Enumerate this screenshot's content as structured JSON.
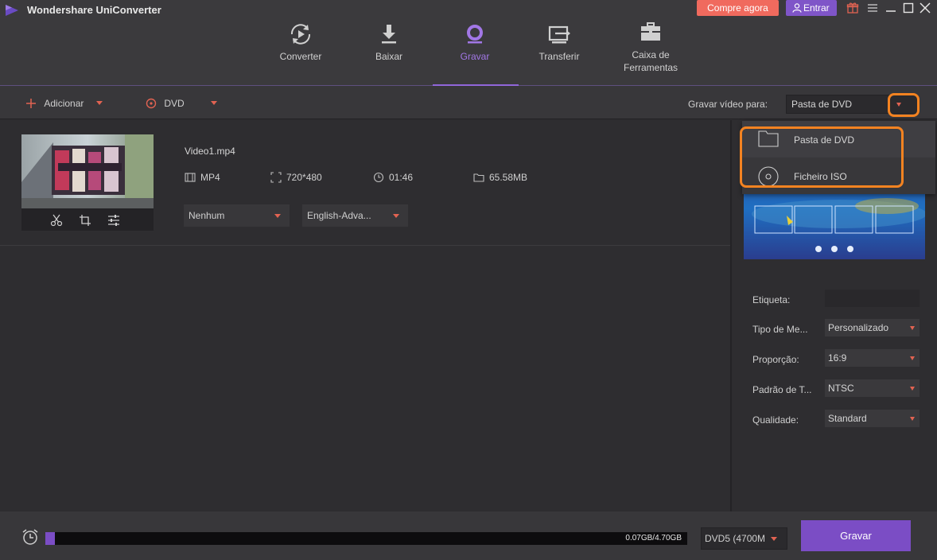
{
  "app": {
    "title": "Wondershare UniConverter"
  },
  "header": {
    "buy_label": "Compre agora",
    "login_label": "Entrar"
  },
  "nav": [
    {
      "label": "Converter",
      "icon": "convert-icon"
    },
    {
      "label": "Baixar",
      "icon": "download-icon"
    },
    {
      "label": "Gravar",
      "icon": "burn-disc-icon",
      "active": true
    },
    {
      "label": "Transferir",
      "icon": "transfer-icon"
    },
    {
      "label": "Caixa de",
      "label2": "Ferramentas",
      "icon": "toolbox-icon"
    }
  ],
  "toolbar": {
    "add_label": "Adicionar",
    "dvd_label": "DVD",
    "burn_to_label": "Gravar vídeo para:",
    "burn_to_value": "Pasta de DVD"
  },
  "dropdown": {
    "options": [
      {
        "label": "Pasta de DVD",
        "icon": "folder-icon"
      },
      {
        "label": "Ficheiro ISO",
        "icon": "disc-icon"
      }
    ]
  },
  "file": {
    "name": "Video1.mp4",
    "format": "MP4",
    "resolution": "720*480",
    "duration": "01:46",
    "size": "65.58MB",
    "subtitle": "Nenhum",
    "audio": "English-Adva..."
  },
  "settings": {
    "label_field": "Etiqueta:",
    "label_value": "",
    "menu_type_label": "Tipo de Me...",
    "menu_type_value": "Personalizado",
    "aspect_label": "Proporção:",
    "aspect_value": "16:9",
    "tv_standard_label": "Padrão de T...",
    "tv_standard_value": "NTSC",
    "quality_label": "Qualidade:",
    "quality_value": "Standard"
  },
  "footer": {
    "usage_text": "0.07GB/4.70GB",
    "usage_fraction": 0.015,
    "disc_type": "DVD5 (4700M",
    "burn_label": "Gravar"
  },
  "colors": {
    "accent": "#7b4dc5",
    "highlight": "#f48321",
    "buy": "#f06a5e",
    "caret": "#e26352"
  }
}
